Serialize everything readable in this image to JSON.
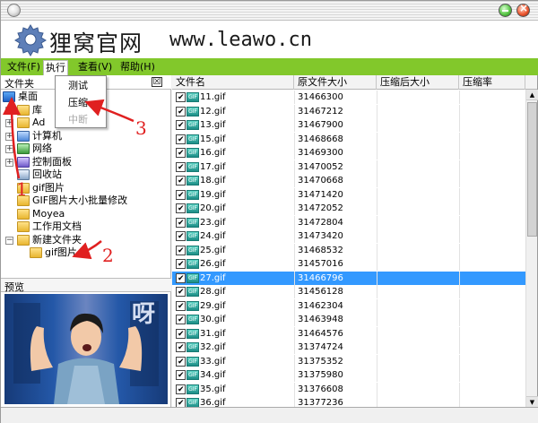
{
  "banner": {
    "brand": "狸窝官网",
    "site": "www.leawo.cn"
  },
  "menubar": {
    "file": "文件(F)",
    "exec": "执行",
    "view": "查看(V)",
    "help": "帮助(H)"
  },
  "dropdown": {
    "items": [
      {
        "label": "测试",
        "enabled": true
      },
      {
        "label": "压缩",
        "enabled": true
      },
      {
        "label": "中断",
        "enabled": false
      }
    ]
  },
  "folder_panel": {
    "title": "文件夹",
    "close_label": "☒",
    "tree": [
      {
        "label": "桌面",
        "icon": "desktop-icon",
        "expander": ""
      },
      {
        "label": "库",
        "icon": "folder-icon",
        "expander": "+"
      },
      {
        "label": "Ad",
        "icon": "folder-icon",
        "expander": "+"
      },
      {
        "label": "计算机",
        "icon": "computer-icon",
        "expander": "+"
      },
      {
        "label": "网络",
        "icon": "network-icon",
        "expander": "+"
      },
      {
        "label": "控制面板",
        "icon": "control-panel-icon",
        "expander": "+"
      },
      {
        "label": "回收站",
        "icon": "recycle-bin-icon",
        "expander": ""
      },
      {
        "label": "gif图片",
        "icon": "folder-icon",
        "expander": ""
      },
      {
        "label": "GIF图片大小批量修改",
        "icon": "folder-icon",
        "expander": ""
      },
      {
        "label": "Moyea",
        "icon": "folder-icon",
        "expander": ""
      },
      {
        "label": "工作用文档",
        "icon": "folder-icon",
        "expander": ""
      },
      {
        "label": "新建文件夹",
        "icon": "folder-icon",
        "expander": "−"
      },
      {
        "label": "gif图片",
        "icon": "folder-icon",
        "expander": ""
      }
    ]
  },
  "preview_panel": {
    "title": "预览",
    "watermark": "呀"
  },
  "file_table": {
    "columns": [
      "文件名",
      "原文件大小",
      "压缩后大小",
      "压缩率"
    ],
    "rows": [
      {
        "name": "11.gif",
        "size": "31466300"
      },
      {
        "name": "12.gif",
        "size": "31467212"
      },
      {
        "name": "13.gif",
        "size": "31467900"
      },
      {
        "name": "15.gif",
        "size": "31468668"
      },
      {
        "name": "16.gif",
        "size": "31469300"
      },
      {
        "name": "17.gif",
        "size": "31470052"
      },
      {
        "name": "18.gif",
        "size": "31470668"
      },
      {
        "name": "19.gif",
        "size": "31471420"
      },
      {
        "name": "20.gif",
        "size": "31472052"
      },
      {
        "name": "23.gif",
        "size": "31472804"
      },
      {
        "name": "24.gif",
        "size": "31473420"
      },
      {
        "name": "25.gif",
        "size": "31468532"
      },
      {
        "name": "26.gif",
        "size": "31457016"
      },
      {
        "name": "27.gif",
        "size": "31466796",
        "selected": true
      },
      {
        "name": "28.gif",
        "size": "31456128"
      },
      {
        "name": "29.gif",
        "size": "31462304"
      },
      {
        "name": "30.gif",
        "size": "31463948"
      },
      {
        "name": "31.gif",
        "size": "31464576"
      },
      {
        "name": "32.gif",
        "size": "31374724"
      },
      {
        "name": "33.gif",
        "size": "31375352"
      },
      {
        "name": "34.gif",
        "size": "31375980"
      },
      {
        "name": "35.gif",
        "size": "31376608"
      },
      {
        "name": "36.gif",
        "size": "31377236"
      }
    ]
  },
  "annotations": [
    "1",
    "2",
    "3"
  ],
  "icon_label": "GIF",
  "colors": {
    "menubar": "#82c82b",
    "selection": "#3399ff",
    "annotation": "#e02020"
  }
}
